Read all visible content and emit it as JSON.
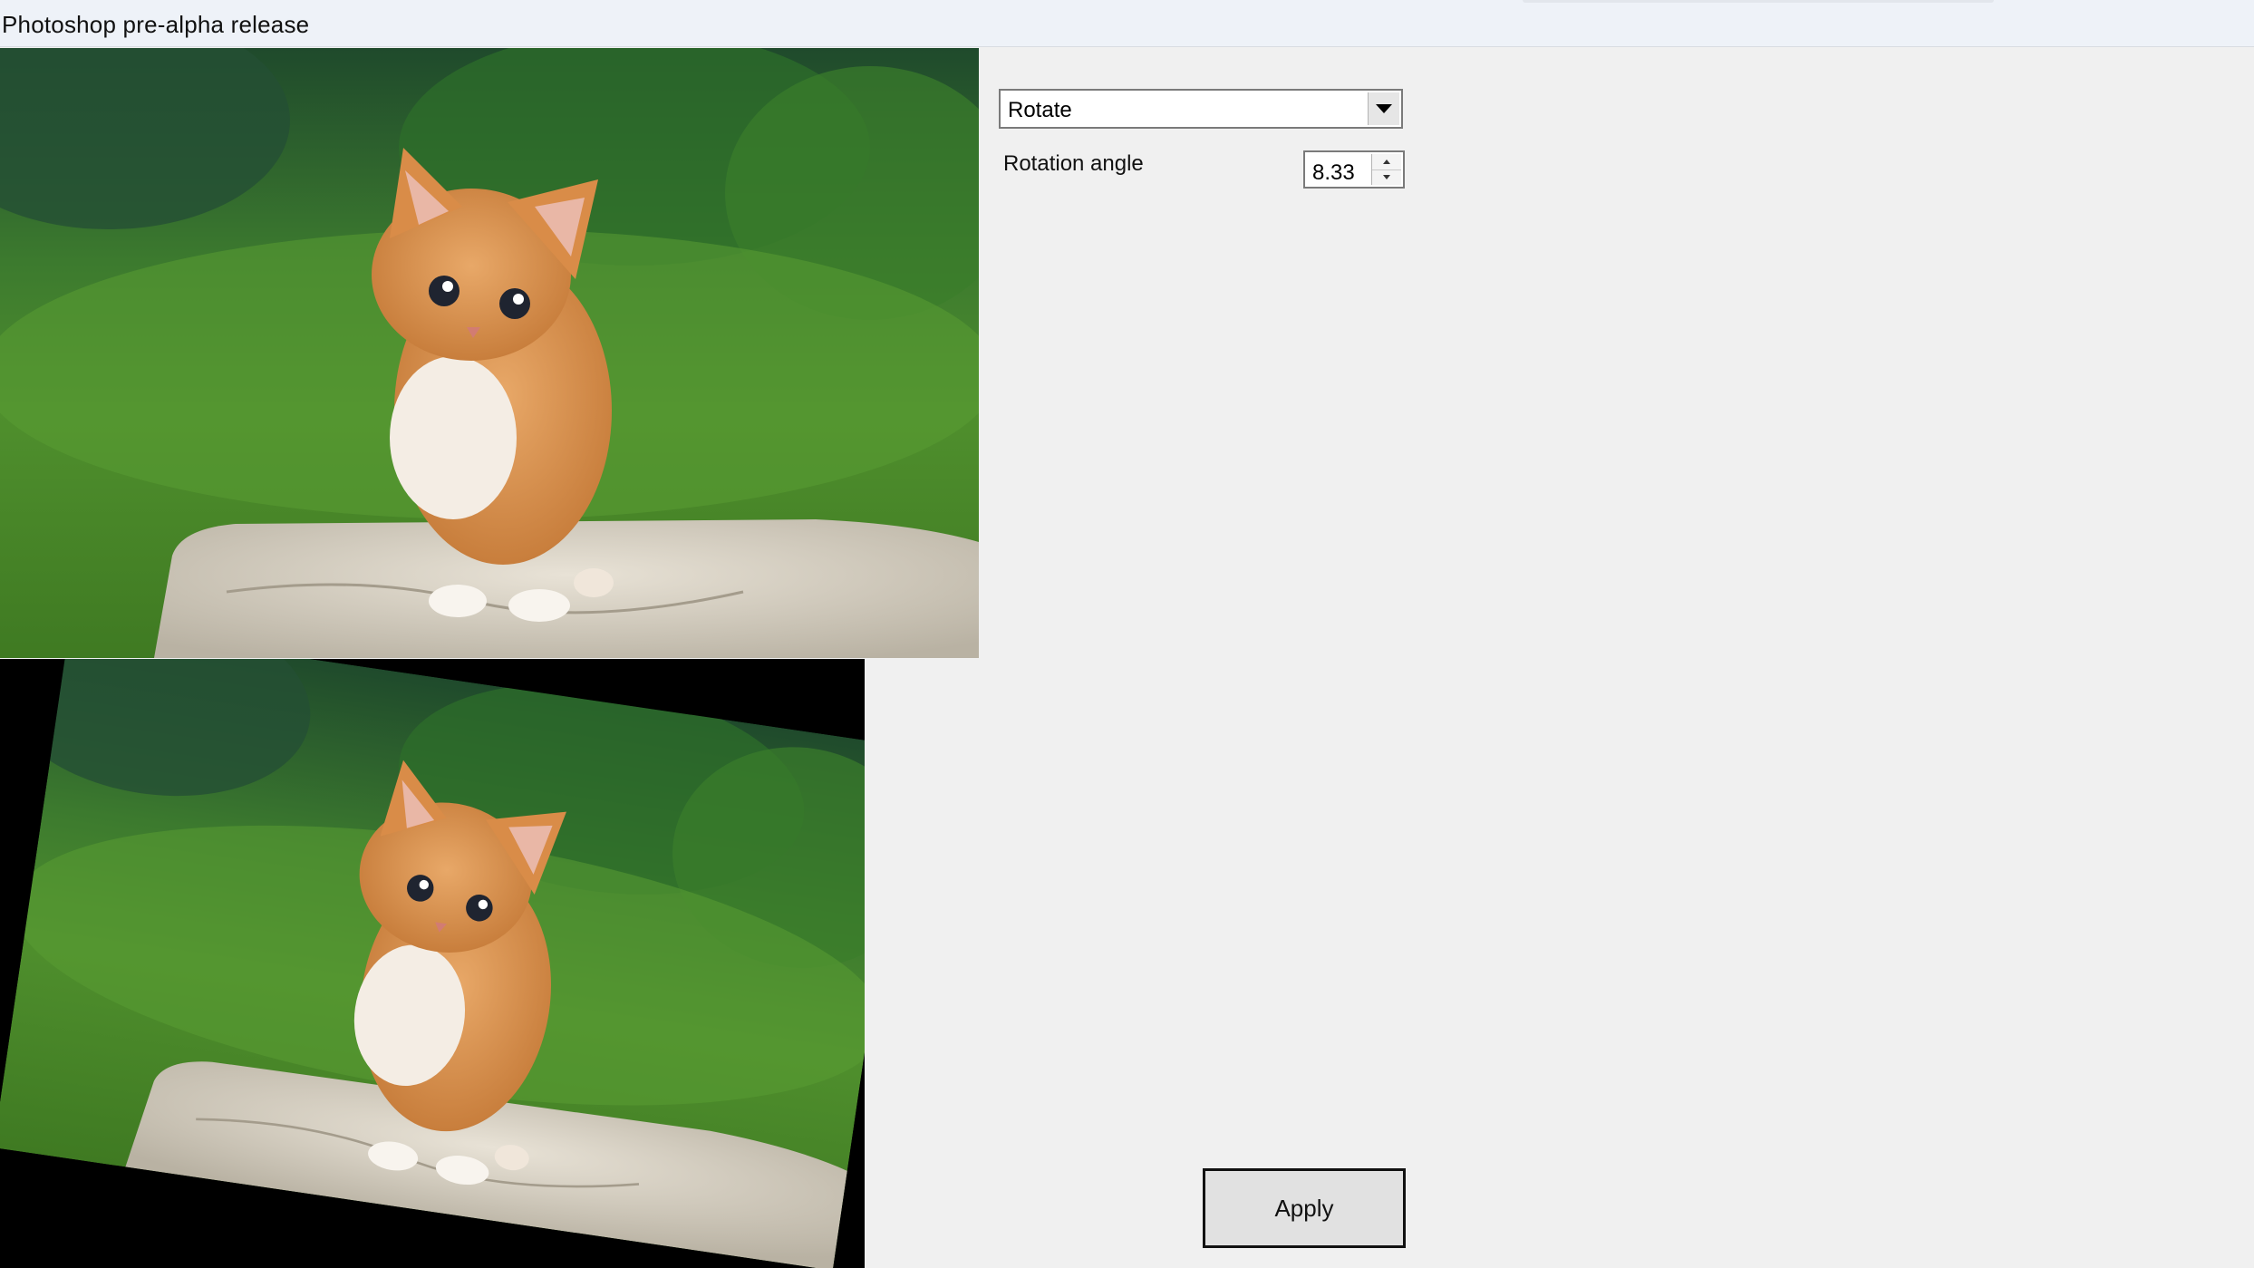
{
  "window": {
    "title": "Photoshop pre-alpha release"
  },
  "images": {
    "original": {
      "alt_icon": "kitten-photo"
    },
    "result": {
      "alt_icon": "kitten-photo-rotated",
      "angle_deg": 8.33
    }
  },
  "controls": {
    "operation": {
      "selected": "Rotate"
    },
    "rotation": {
      "label": "Rotation angle",
      "value": "8.33"
    },
    "apply_label": "Apply"
  }
}
